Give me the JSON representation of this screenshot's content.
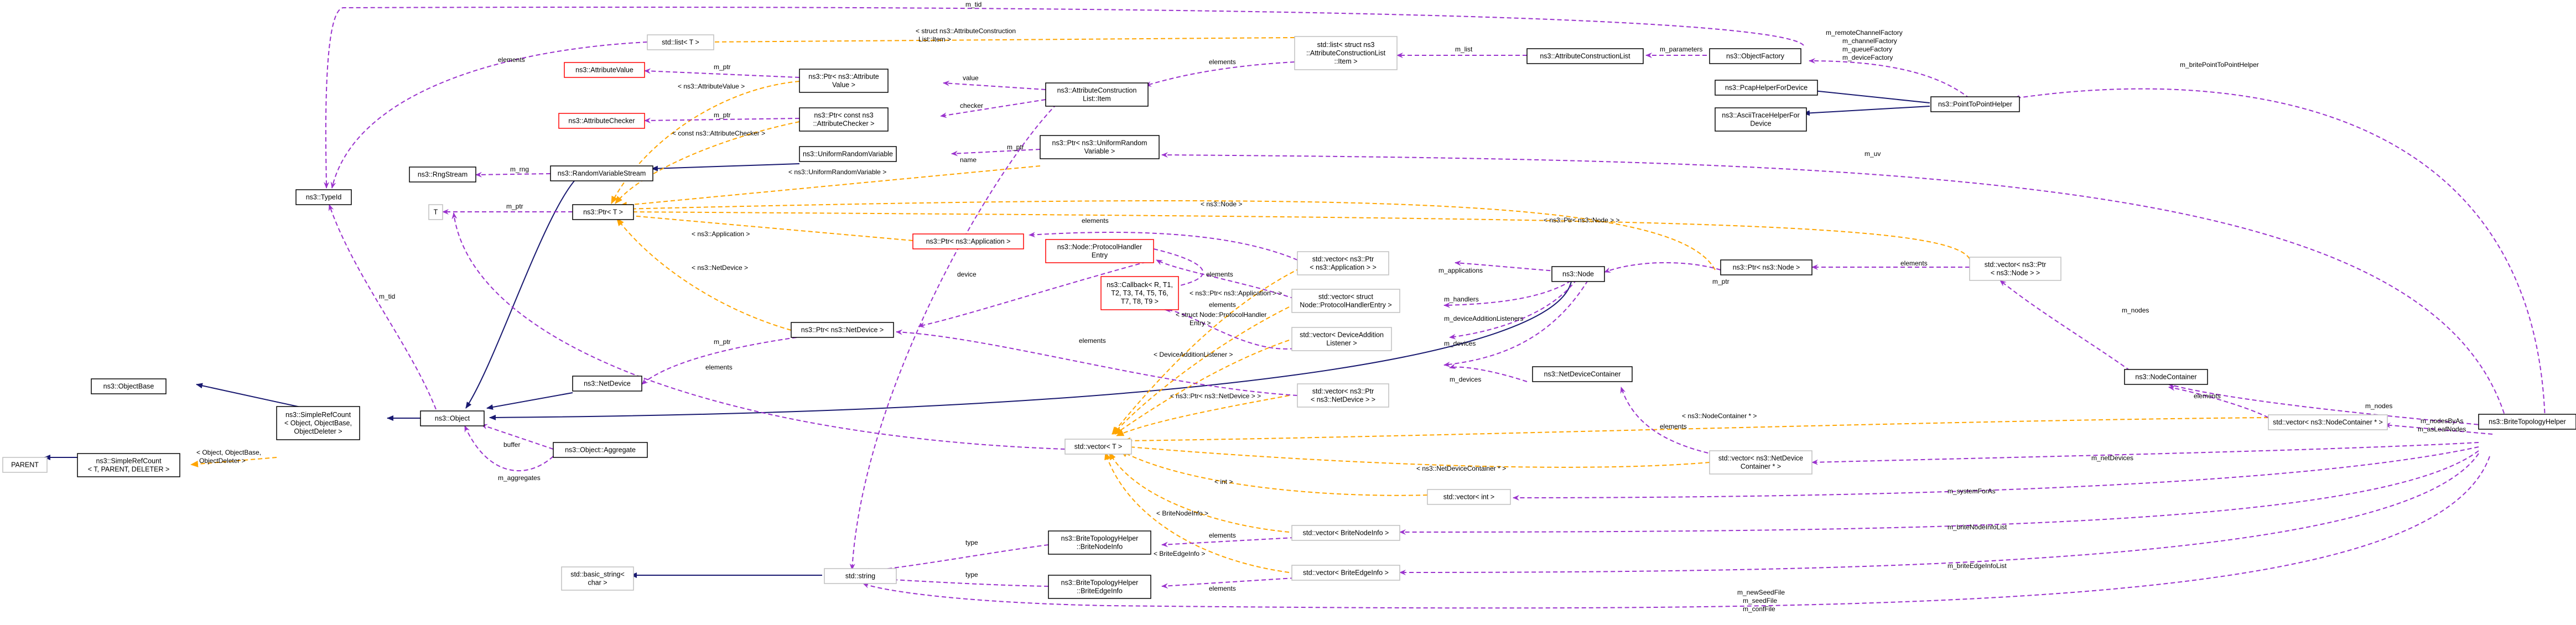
{
  "nodes": {
    "n_brite_topology_helper": {
      "lines": [
        "ns3::BriteTopologyHelper"
      ]
    },
    "n_node_container": {
      "lines": [
        "ns3::NodeContainer"
      ]
    },
    "n_vector_ptr_node": {
      "lines": [
        "std::vector< ns3::Ptr",
        "< ns3::Node > >"
      ]
    },
    "n_ptr_node": {
      "lines": [
        "ns3::Ptr< ns3::Node >"
      ]
    },
    "n_node": {
      "lines": [
        "ns3::Node"
      ]
    },
    "n_vector_ptr_application": {
      "lines": [
        "std::vector< ns3::Ptr",
        "< ns3::Application > >"
      ]
    },
    "n_vector_struct_node_protocolhandlerentry": {
      "lines": [
        "std::vector< struct",
        "Node::ProtocolHandlerEntry >"
      ]
    },
    "n_vector_deviceadditionlistener": {
      "lines": [
        "std::vector< DeviceAddition",
        "Listener >"
      ]
    },
    "n_vector_ptr_netdevice": {
      "lines": [
        "std::vector< ns3::Ptr",
        "< ns3::NetDevice > >"
      ]
    },
    "n_netdevice_container": {
      "lines": [
        "ns3::NetDeviceContainer"
      ]
    },
    "n_vector_nodecontainer_ptr": {
      "lines": [
        "std::vector< ns3::NodeContainer * >"
      ]
    },
    "n_vector_netdevicecontainer_ptr": {
      "lines": [
        "std::vector< ns3::NetDevice",
        "Container * >"
      ]
    },
    "n_vector_int": {
      "lines": [
        "std::vector< int >"
      ]
    },
    "n_vector_britenodeinfo": {
      "lines": [
        "std::vector< BriteNodeInfo >"
      ]
    },
    "n_vector_briteedgeinfo": {
      "lines": [
        "std::vector< BriteEdgeInfo >"
      ]
    },
    "n_point_to_point_helper": {
      "lines": [
        "ns3::PointToPointHelper"
      ]
    },
    "n_pcap_helper_for_device": {
      "lines": [
        "ns3::PcapHelperForDevice"
      ]
    },
    "n_ascii_trace_helper_for_device": {
      "lines": [
        "ns3::AsciiTraceHelperFor",
        "Device"
      ]
    },
    "n_object_factory": {
      "lines": [
        "ns3::ObjectFactory"
      ]
    },
    "n_attribute_construction_list": {
      "lines": [
        "ns3::AttributeConstructionList"
      ]
    },
    "n_list_struct_item": {
      "lines": [
        "std::list< struct ns3",
        "::AttributeConstructionList",
        "::Item >"
      ]
    },
    "n_list_t": {
      "lines": [
        "std::list< T >"
      ]
    },
    "n_attribute_construction_list_item": {
      "lines": [
        "ns3::AttributeConstruction",
        "List::Item"
      ]
    },
    "n_ptr_attribute_value": {
      "lines": [
        "ns3::Ptr< ns3::Attribute",
        "Value >"
      ]
    },
    "n_ptr_const_attribute_checker": {
      "lines": [
        "ns3::Ptr< const ns3",
        "::AttributeChecker >"
      ]
    },
    "n_attribute_value": {
      "lines": [
        "ns3::AttributeValue"
      ]
    },
    "n_attribute_checker": {
      "lines": [
        "ns3::AttributeChecker"
      ]
    },
    "n_ptr_uniform_random_variable": {
      "lines": [
        "ns3::Ptr< ns3::UniformRandom",
        "Variable >"
      ]
    },
    "n_uniform_random_variable": {
      "lines": [
        "ns3::UniformRandomVariable"
      ]
    },
    "n_random_variable_stream": {
      "lines": [
        "ns3::RandomVariableStream"
      ]
    },
    "n_rng_stream": {
      "lines": [
        "ns3::RngStream"
      ]
    },
    "n_ptr_t": {
      "lines": [
        "ns3::Ptr< T >"
      ]
    },
    "n_t": {
      "lines": [
        "T"
      ]
    },
    "n_type_id": {
      "lines": [
        "ns3::TypeId"
      ]
    },
    "n_ptr_application": {
      "lines": [
        "ns3::Ptr< ns3::Application >"
      ]
    },
    "n_protocol_handler_entry": {
      "lines": [
        "ns3::Node::ProtocolHandler",
        "Entry"
      ]
    },
    "n_callback": {
      "lines": [
        "ns3::Callback< R, T1,",
        "T2, T3, T4, T5, T6,",
        "T7, T8, T9 >"
      ]
    },
    "n_ptr_netdevice": {
      "lines": [
        "ns3::Ptr< ns3::NetDevice >"
      ]
    },
    "n_netdevice": {
      "lines": [
        "ns3::NetDevice"
      ]
    },
    "n_object": {
      "lines": [
        "ns3::Object"
      ]
    },
    "n_object_aggregate": {
      "lines": [
        "ns3::Object::Aggregate"
      ]
    },
    "n_simple_ref_count_object": {
      "lines": [
        "ns3::SimpleRefCount",
        "< Object, ObjectBase,",
        "ObjectDeleter >"
      ]
    },
    "n_object_base": {
      "lines": [
        "ns3::ObjectBase"
      ]
    },
    "n_simple_ref_count_t": {
      "lines": [
        "ns3::SimpleRefCount",
        "< T, PARENT, DELETER >"
      ]
    },
    "n_parent": {
      "lines": [
        "PARENT"
      ]
    },
    "n_vector_t": {
      "lines": [
        "std::vector< T >"
      ]
    },
    "n_std_string": {
      "lines": [
        "std::string"
      ]
    },
    "n_basic_string": {
      "lines": [
        "std::basic_string<",
        "char >"
      ]
    },
    "n_britenodeinfo": {
      "lines": [
        "ns3::BriteTopologyHelper",
        "::BriteNodeInfo"
      ]
    },
    "n_briteedgeinfo": {
      "lines": [
        "ns3::BriteTopologyHelper",
        "::BriteEdgeInfo"
      ]
    }
  },
  "edge_labels": {
    "m_nodes": "m_nodes",
    "m_nodes_by_as_m_as_leaf_nodes": [
      "m_nodesByAs",
      "m_asLeafNodes"
    ],
    "m_net_devices": "m_netDevices",
    "m_system_for_as": "m_systemForAs",
    "m_brite_node_info_list": "m_briteNodeInfoList",
    "m_brite_edge_info_list": "m_briteEdgeInfoList",
    "m_seed_files": [
      "m_newSeedFile",
      "m_seedFile",
      "m_confFile"
    ],
    "m_uv": "m_uv",
    "m_brite_point_to_point_helper": "m_britePointToPointHelper",
    "factories": [
      "m_remoteChannelFactory",
      "m_channelFactory",
      "m_queueFactory",
      "m_deviceFactory"
    ],
    "m_tid_top": "m_tid",
    "m_parameters": "m_parameters",
    "m_list": "m_list",
    "elements": "elements",
    "struct_item": [
      "< struct ns3::AttributeConstruction",
      "List::Item >"
    ],
    "value": "value",
    "checker": "checker",
    "m_ptr": "m_ptr",
    "ptr_attribute_value": "< ns3::AttributeValue >",
    "ptr_const_attribute_checker": "< const ns3::AttributeChecker >",
    "ptr_uniform_random_variable": "< ns3::UniformRandomVariable >",
    "m_rng": "m_rng",
    "name": "name",
    "m_tid": "m_tid",
    "ptr_node": "< ns3::Node >",
    "ptr_ptr_node": "< ns3::Ptr< ns3::Node > >",
    "ptr_application": "< ns3::Application >",
    "ptr_netdevice": "< ns3::NetDevice >",
    "device": "device",
    "m_applications": "m_applications",
    "m_handlers": "m_handlers",
    "m_device_addition_listeners": "m_deviceAdditionListeners",
    "m_devices": "m_devices",
    "ptr_application_angle": "< ns3::Ptr< ns3::Application > >",
    "struct_node_protocol_handler_entry": [
      "< struct Node::ProtocolHandler",
      "Entry >"
    ],
    "device_addition_listener": "< DeviceAdditionListener >",
    "ptr_netdevice_angle": "< ns3::Ptr< ns3::NetDevice > >",
    "nodecontainer_ptr": "< ns3::NodeContainer * >",
    "netdevicecontainer_ptr": "< ns3::NetDeviceContainer * >",
    "int": "< int >",
    "britenodeinfo": "< BriteNodeInfo >",
    "briteedgeinfo": "< BriteEdgeInfo >",
    "object_simple_ref_count": [
      "< Object, ObjectBase,",
      "ObjectDeleter >"
    ],
    "buffer": "buffer",
    "m_aggregates": "m_aggregates",
    "type": "type"
  },
  "colors": {
    "inheritance": "#191970",
    "usage": "#9a32cd",
    "template": "#ffa500",
    "highlight_fill": "#bfbfbf",
    "border_normal": "#000000",
    "border_undocumented": "#ff0000",
    "border_external": "#bfbfbf"
  }
}
